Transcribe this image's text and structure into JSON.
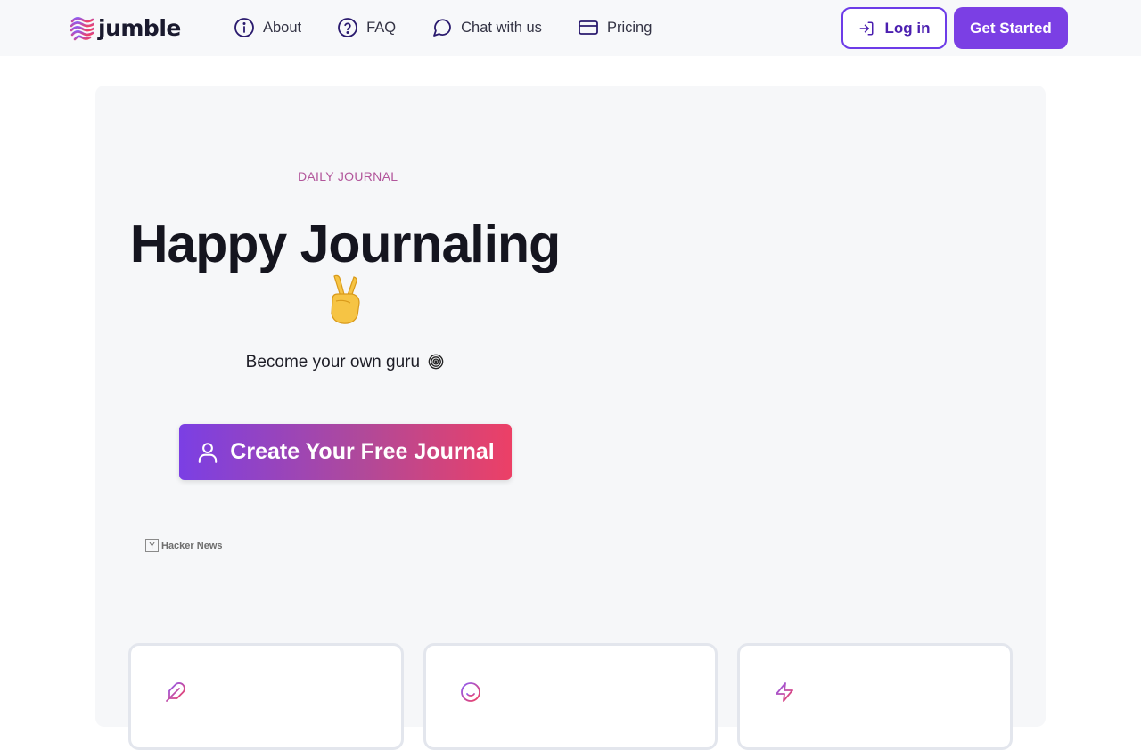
{
  "brand": {
    "name": "jumble"
  },
  "nav": {
    "items": [
      {
        "label": "About",
        "icon": "info-icon"
      },
      {
        "label": "FAQ",
        "icon": "question-icon"
      },
      {
        "label": "Chat with us",
        "icon": "chat-bubble-icon"
      },
      {
        "label": "Pricing",
        "icon": "credit-card-icon"
      }
    ],
    "login_label": "Log in",
    "get_started_label": "Get Started"
  },
  "hero": {
    "eyebrow": "DAILY JOURNAL",
    "title": "Happy Journaling",
    "subtitle": "Become your own guru",
    "cta_label": "Create Your Free Journal",
    "badge": {
      "mark": "Y",
      "text": "Hacker News"
    }
  },
  "features": [
    {
      "icon": "feather-icon"
    },
    {
      "icon": "smiley-icon"
    },
    {
      "icon": "lightning-icon"
    }
  ],
  "colors": {
    "accent": "#7b3fe4",
    "gradient_start": "#7b3fe4",
    "gradient_end": "#ec4066",
    "eyebrow": "#b2569b"
  }
}
